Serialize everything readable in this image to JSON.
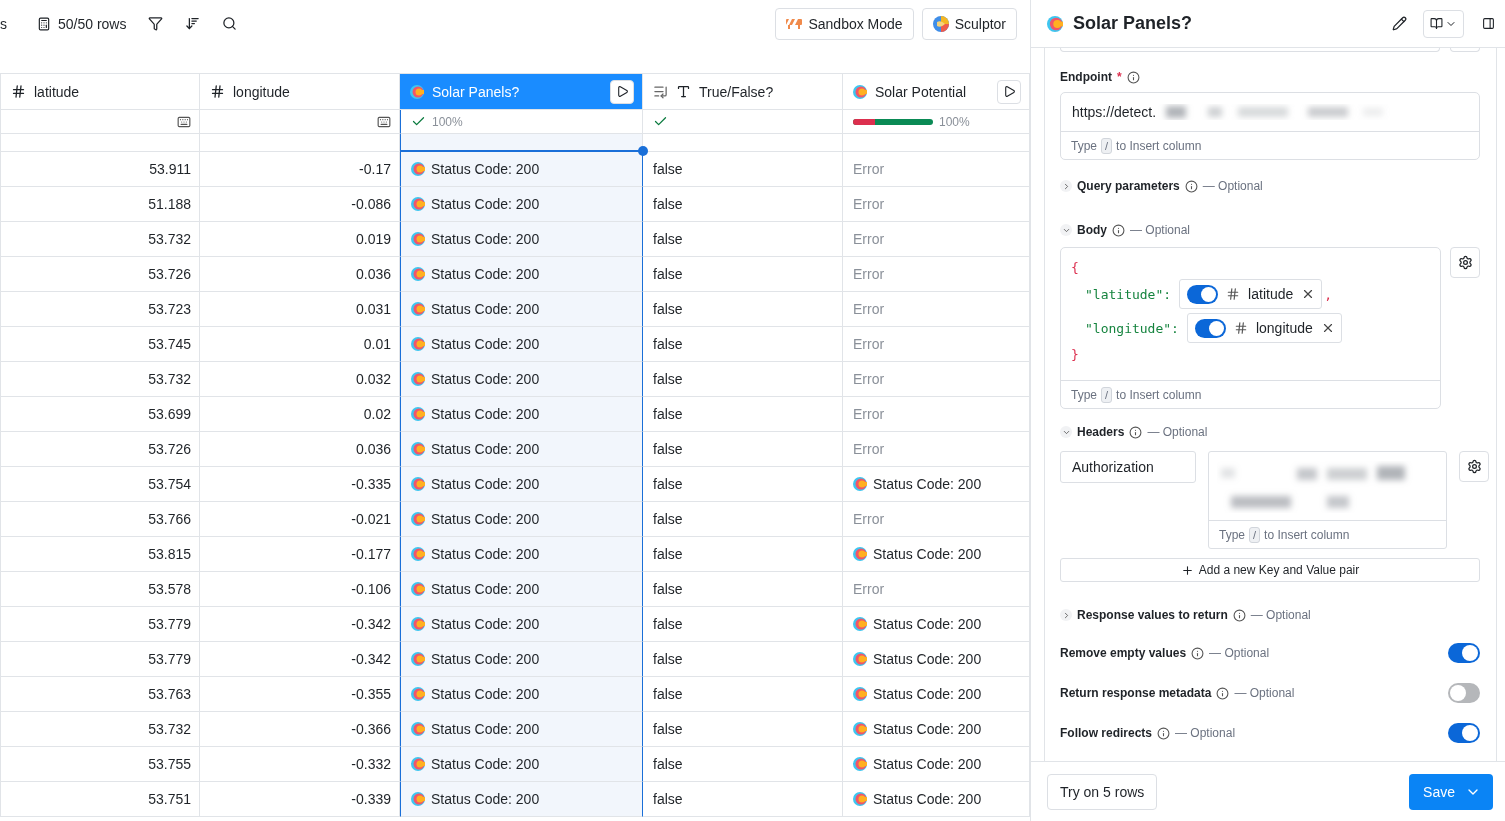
{
  "toolbar": {
    "cut_label": "s",
    "row_count": "50/50 rows",
    "buttons": [
      {
        "label": "Sandbox Mode",
        "kind": "sandbox"
      },
      {
        "label": "Sculptor",
        "kind": "sculptor"
      }
    ]
  },
  "table": {
    "columns": [
      {
        "label": "latitude",
        "kind": "number",
        "selected": false,
        "run_button": false
      },
      {
        "label": "longitude",
        "kind": "number",
        "selected": false,
        "run_button": false
      },
      {
        "label": "Solar Panels?",
        "kind": "ai",
        "selected": true,
        "run_button": true
      },
      {
        "label": "True/False?",
        "kind": "text",
        "selected": false,
        "run_button": false
      },
      {
        "label": "Solar Potential",
        "kind": "ai",
        "selected": false,
        "run_button": true
      }
    ],
    "summary": [
      {
        "kind": "keyboard"
      },
      {
        "kind": "keyboard"
      },
      {
        "kind": "check",
        "text": "100%"
      },
      {
        "kind": "check"
      },
      {
        "kind": "progress",
        "level": 0.28,
        "text": "100%"
      }
    ],
    "rows": [
      {
        "latitude": "53.911",
        "longitude": "-0.17",
        "solar_panels": "Status Code: 200",
        "true_false": "false",
        "solar_potential": {
          "text": "Error",
          "kind": "error"
        }
      },
      {
        "latitude": "51.188",
        "longitude": "-0.086",
        "solar_panels": "Status Code: 200",
        "true_false": "false",
        "solar_potential": {
          "text": "Error",
          "kind": "error"
        }
      },
      {
        "latitude": "53.732",
        "longitude": "0.019",
        "solar_panels": "Status Code: 200",
        "true_false": "false",
        "solar_potential": {
          "text": "Error",
          "kind": "error"
        }
      },
      {
        "latitude": "53.726",
        "longitude": "0.036",
        "solar_panels": "Status Code: 200",
        "true_false": "false",
        "solar_potential": {
          "text": "Error",
          "kind": "error"
        }
      },
      {
        "latitude": "53.723",
        "longitude": "0.031",
        "solar_panels": "Status Code: 200",
        "true_false": "false",
        "solar_potential": {
          "text": "Error",
          "kind": "error"
        }
      },
      {
        "latitude": "53.745",
        "longitude": "0.01",
        "solar_panels": "Status Code: 200",
        "true_false": "false",
        "solar_potential": {
          "text": "Error",
          "kind": "error"
        }
      },
      {
        "latitude": "53.732",
        "longitude": "0.032",
        "solar_panels": "Status Code: 200",
        "true_false": "false",
        "solar_potential": {
          "text": "Error",
          "kind": "error"
        }
      },
      {
        "latitude": "53.699",
        "longitude": "0.02",
        "solar_panels": "Status Code: 200",
        "true_false": "false",
        "solar_potential": {
          "text": "Error",
          "kind": "error"
        }
      },
      {
        "latitude": "53.726",
        "longitude": "0.036",
        "solar_panels": "Status Code: 200",
        "true_false": "false",
        "solar_potential": {
          "text": "Error",
          "kind": "error"
        }
      },
      {
        "latitude": "53.754",
        "longitude": "-0.335",
        "solar_panels": "Status Code: 200",
        "true_false": "false",
        "solar_potential": {
          "text": "Status Code: 200",
          "kind": "ok"
        }
      },
      {
        "latitude": "53.766",
        "longitude": "-0.021",
        "solar_panels": "Status Code: 200",
        "true_false": "false",
        "solar_potential": {
          "text": "Error",
          "kind": "error"
        }
      },
      {
        "latitude": "53.815",
        "longitude": "-0.177",
        "solar_panels": "Status Code: 200",
        "true_false": "false",
        "solar_potential": {
          "text": "Status Code: 200",
          "kind": "ok"
        }
      },
      {
        "latitude": "53.578",
        "longitude": "-0.106",
        "solar_panels": "Status Code: 200",
        "true_false": "false",
        "solar_potential": {
          "text": "Error",
          "kind": "error"
        }
      },
      {
        "latitude": "53.779",
        "longitude": "-0.342",
        "solar_panels": "Status Code: 200",
        "true_false": "false",
        "solar_potential": {
          "text": "Status Code: 200",
          "kind": "ok"
        }
      },
      {
        "latitude": "53.779",
        "longitude": "-0.342",
        "solar_panels": "Status Code: 200",
        "true_false": "false",
        "solar_potential": {
          "text": "Status Code: 200",
          "kind": "ok"
        }
      },
      {
        "latitude": "53.763",
        "longitude": "-0.355",
        "solar_panels": "Status Code: 200",
        "true_false": "false",
        "solar_potential": {
          "text": "Status Code: 200",
          "kind": "ok"
        }
      },
      {
        "latitude": "53.732",
        "longitude": "-0.366",
        "solar_panels": "Status Code: 200",
        "true_false": "false",
        "solar_potential": {
          "text": "Status Code: 200",
          "kind": "ok"
        }
      },
      {
        "latitude": "53.755",
        "longitude": "-0.332",
        "solar_panels": "Status Code: 200",
        "true_false": "false",
        "solar_potential": {
          "text": "Status Code: 200",
          "kind": "ok"
        }
      },
      {
        "latitude": "53.751",
        "longitude": "-0.339",
        "solar_panels": "Status Code: 200",
        "true_false": "false",
        "solar_potential": {
          "text": "Status Code: 200",
          "kind": "ok"
        }
      }
    ]
  },
  "panel": {
    "title": "Solar Panels?",
    "endpoint": {
      "label": "Endpoint",
      "required_mark": "*",
      "value": "https://detect.",
      "hint": {
        "before": "Type",
        "key": "/",
        "after": "to Insert column"
      }
    },
    "sections": [
      {
        "kind": "collapsible",
        "title": "Query parameters",
        "note": "— Optional",
        "expanded": false
      },
      {
        "kind": "body",
        "title": "Body",
        "note": "— Optional",
        "expanded": true,
        "open_brace": "{",
        "close_brace": "}",
        "entries": [
          {
            "key": "\"latitude\":",
            "column": "latitude",
            "on": true,
            "separator": ","
          },
          {
            "key": "\"longitude\":",
            "column": "longitude",
            "on": true
          }
        ],
        "hint": {
          "before": "Type",
          "key": "/",
          "after": "to Insert column"
        }
      },
      {
        "kind": "headers",
        "title": "Headers",
        "note": "— Optional",
        "expanded": true,
        "header_key": "Authorization",
        "hint": {
          "before": "Type",
          "key": "/",
          "after": "to Insert column"
        },
        "add_label": "Add a new Key and Value pair"
      },
      {
        "kind": "collapsible",
        "title": "Response values to return",
        "note": "— Optional",
        "expanded": false
      },
      {
        "kind": "toggle",
        "title": "Remove empty values",
        "note": "— Optional",
        "on": true
      },
      {
        "kind": "toggle",
        "title": "Return response metadata",
        "note": "— Optional",
        "on": false
      },
      {
        "kind": "toggle",
        "title": "Follow redirects",
        "note": "— Optional",
        "on": true
      }
    ]
  },
  "footer": {
    "try_label": "Try on 5 rows",
    "save_label": "Save"
  }
}
